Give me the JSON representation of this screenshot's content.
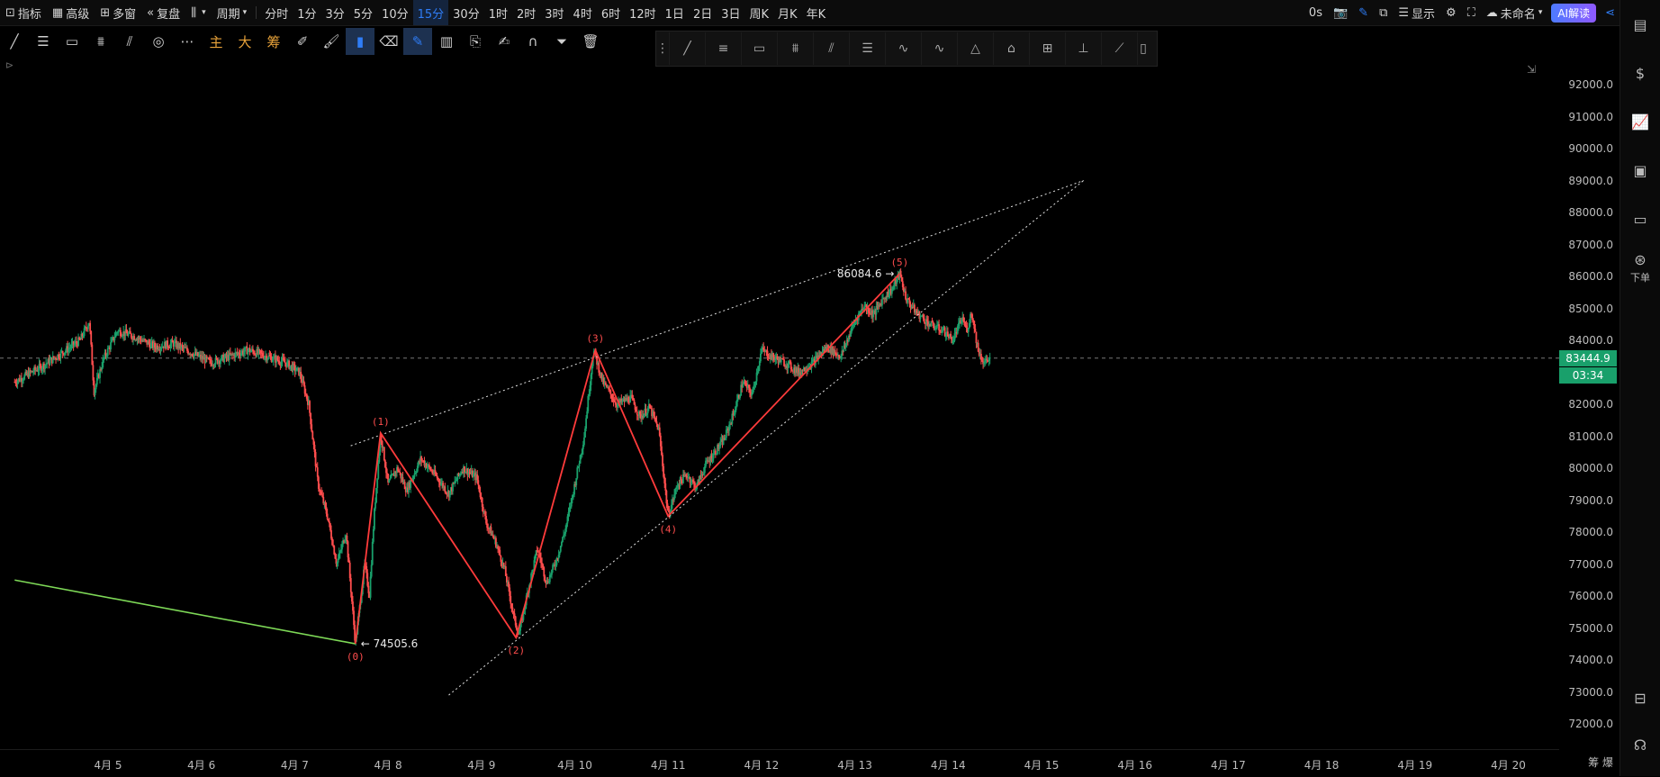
{
  "topbar": {
    "left_items": [
      {
        "icon": "indicator-icon",
        "label": "指标"
      },
      {
        "icon": "calendar-icon",
        "label": "高级"
      },
      {
        "icon": "grid-icon",
        "label": "多窗"
      },
      {
        "icon": "rewind-icon",
        "label": "复盘"
      },
      {
        "icon": "candle-type-icon",
        "label": ""
      },
      {
        "icon": "",
        "label": "周期"
      }
    ],
    "periods": [
      "分时",
      "1分",
      "3分",
      "5分",
      "10分",
      "15分",
      "30分",
      "1时",
      "2时",
      "3时",
      "4时",
      "6时",
      "12时",
      "1日",
      "2日",
      "3日",
      "周K",
      "月K",
      "年K"
    ],
    "active_period": "15分",
    "right": {
      "timer": "0s",
      "display_label": "显示",
      "unnamed_label": "未命名",
      "ai_label": "AI解读"
    }
  },
  "toolbar2": {
    "chars": [
      "主",
      "大",
      "筹"
    ]
  },
  "chart_data": {
    "type": "candlestick",
    "title": "",
    "x_dates": [
      "4月 5",
      "4月 6",
      "4月 7",
      "4月 8",
      "4月 9",
      "4月 10",
      "4月 11",
      "4月 12",
      "4月 13",
      "4月 14",
      "4月 15",
      "4月 16",
      "4月 17",
      "4月 18",
      "4月 19",
      "4月 20"
    ],
    "y_ticks": [
      92000.0,
      91000.0,
      90000.0,
      89000.0,
      88000.0,
      87000.0,
      86000.0,
      85000.0,
      84000.0,
      83000.0,
      82000.0,
      81000.0,
      80000.0,
      79000.0,
      78000.0,
      77000.0,
      76000.0,
      75000.0,
      74000.0,
      73000.0,
      72000.0
    ],
    "ylim": [
      71500,
      93000
    ],
    "xlim": [
      4.0,
      20.5
    ],
    "current_price": "83444.9",
    "countdown": "03:34",
    "price_path": [
      [
        4.0,
        82700
      ],
      [
        4.3,
        83200
      ],
      [
        4.5,
        83600
      ],
      [
        4.7,
        84000
      ],
      [
        4.8,
        84600
      ],
      [
        4.85,
        82400
      ],
      [
        4.95,
        83400
      ],
      [
        5.1,
        84300
      ],
      [
        5.3,
        84100
      ],
      [
        5.5,
        83800
      ],
      [
        5.7,
        83900
      ],
      [
        5.9,
        83600
      ],
      [
        6.1,
        83300
      ],
      [
        6.3,
        83500
      ],
      [
        6.5,
        83700
      ],
      [
        6.7,
        83500
      ],
      [
        6.9,
        83300
      ],
      [
        7.05,
        83000
      ],
      [
        7.15,
        82000
      ],
      [
        7.25,
        79500
      ],
      [
        7.35,
        78500
      ],
      [
        7.45,
        77000
      ],
      [
        7.55,
        78000
      ],
      [
        7.65,
        74505.6
      ],
      [
        7.75,
        77000
      ],
      [
        7.8,
        76000
      ],
      [
        7.85,
        78500
      ],
      [
        7.92,
        81100
      ],
      [
        8.0,
        79500
      ],
      [
        8.1,
        80000
      ],
      [
        8.2,
        79300
      ],
      [
        8.35,
        80300
      ],
      [
        8.5,
        79800
      ],
      [
        8.65,
        79200
      ],
      [
        8.8,
        80000
      ],
      [
        8.95,
        79700
      ],
      [
        9.05,
        78300
      ],
      [
        9.15,
        77700
      ],
      [
        9.25,
        76800
      ],
      [
        9.35,
        75300
      ],
      [
        9.4,
        74800
      ],
      [
        9.5,
        76200
      ],
      [
        9.6,
        77500
      ],
      [
        9.7,
        76400
      ],
      [
        9.8,
        77100
      ],
      [
        9.9,
        78100
      ],
      [
        10.0,
        79500
      ],
      [
        10.1,
        81000
      ],
      [
        10.2,
        83700
      ],
      [
        10.3,
        82700
      ],
      [
        10.45,
        82000
      ],
      [
        10.6,
        82200
      ],
      [
        10.7,
        81600
      ],
      [
        10.8,
        81900
      ],
      [
        10.9,
        81200
      ],
      [
        11.0,
        78500
      ],
      [
        11.1,
        79500
      ],
      [
        11.2,
        79800
      ],
      [
        11.3,
        79400
      ],
      [
        11.4,
        80100
      ],
      [
        11.5,
        80500
      ],
      [
        11.6,
        80900
      ],
      [
        11.7,
        81700
      ],
      [
        11.8,
        82700
      ],
      [
        11.9,
        82300
      ],
      [
        12.0,
        83700
      ],
      [
        12.1,
        83500
      ],
      [
        12.25,
        83300
      ],
      [
        12.4,
        83000
      ],
      [
        12.55,
        83300
      ],
      [
        12.7,
        83800
      ],
      [
        12.85,
        83500
      ],
      [
        13.0,
        84600
      ],
      [
        13.1,
        85100
      ],
      [
        13.2,
        84800
      ],
      [
        13.3,
        85300
      ],
      [
        13.4,
        85600
      ],
      [
        13.48,
        86084.6
      ],
      [
        13.55,
        85300
      ],
      [
        13.65,
        84900
      ],
      [
        13.8,
        84500
      ],
      [
        13.95,
        84300
      ],
      [
        14.05,
        84000
      ],
      [
        14.15,
        84700
      ],
      [
        14.2,
        84300
      ],
      [
        14.25,
        84900
      ],
      [
        14.32,
        83700
      ],
      [
        14.38,
        83300
      ],
      [
        14.45,
        83445
      ]
    ],
    "waves": [
      {
        "label": "(0)",
        "x": 7.65,
        "y": 74505.6,
        "pos": "below"
      },
      {
        "label": "(1)",
        "x": 7.92,
        "y": 81100,
        "pos": "above"
      },
      {
        "label": "(2)",
        "x": 9.37,
        "y": 74700,
        "pos": "below"
      },
      {
        "label": "(3)",
        "x": 10.22,
        "y": 83700,
        "pos": "above"
      },
      {
        "label": "(4)",
        "x": 11.0,
        "y": 78500,
        "pos": "below"
      },
      {
        "label": "(5)",
        "x": 13.48,
        "y": 86084.6,
        "pos": "above"
      }
    ],
    "annotations": [
      {
        "text": "← 74505.6",
        "x": 7.65,
        "y": 74505.6,
        "align": "right"
      },
      {
        "text": "86084.6 →",
        "x": 13.48,
        "y": 86084.6,
        "align": "left"
      }
    ],
    "trendlines": [
      {
        "from": [
          7.6,
          80700
        ],
        "to": [
          15.45,
          89000
        ],
        "style": "dotted"
      },
      {
        "from": [
          8.65,
          72900
        ],
        "to": [
          15.45,
          89000
        ],
        "style": "dotted"
      },
      {
        "from": [
          4.0,
          76500
        ],
        "to": [
          7.65,
          74505.6
        ],
        "style": "solid",
        "color": "#7ed957"
      }
    ],
    "colors": {
      "up": "#19a06b",
      "down": "#ff4d4d",
      "wave": "#ff3b3b"
    }
  },
  "xaxis_corner": "筹  爆",
  "sidebar": {
    "order_label": "下单"
  }
}
